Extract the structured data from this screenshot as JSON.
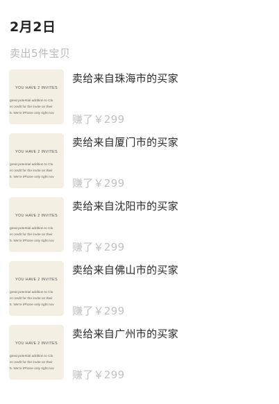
{
  "header": {
    "date": "2月2日",
    "summary": "卖出5件宝贝"
  },
  "items": [
    {
      "title": "卖给来自珠海市的买家",
      "earned": "赚了￥299",
      "thumbnail": {
        "heading": "YOU HAVE 2 INVITES",
        "line1": "great potential addition to Clu",
        "line2": "et credit for the invite on their",
        "line3": "5. We're iPhone only right nov"
      }
    },
    {
      "title": "卖给来自厦门市的买家",
      "earned": "赚了￥299",
      "thumbnail": {
        "heading": "YOU HAVE 2 INVITES",
        "line1": "great potential addition to Clu",
        "line2": "et credit for the invite on their",
        "line3": "5. We're iPhone only right nov"
      }
    },
    {
      "title": "卖给来自沈阳市的买家",
      "earned": "赚了￥299",
      "thumbnail": {
        "heading": "YOU HAVE 2 INVITES",
        "line1": "great potential addition to Clu",
        "line2": "et credit for the invite on their",
        "line3": "5. We're iPhone only right nov"
      }
    },
    {
      "title": "卖给来自佛山市的买家",
      "earned": "赚了￥299",
      "thumbnail": {
        "heading": "YOU HAVE 2 INVITES",
        "line1": "great potential addition to Clu",
        "line2": "et credit for the invite on their",
        "line3": "5. We're iPhone only right nov"
      }
    },
    {
      "title": "卖给来自广州市的买家",
      "earned": "赚了￥299",
      "thumbnail": {
        "heading": "YOU HAVE 2 INVITES",
        "line1": "great potential addition to Clu",
        "line2": "et credit for the invite on their",
        "line3": "5. We're iPhone only right nov"
      }
    }
  ],
  "colors": {
    "thumbnail_bg": "#f3efe3",
    "title_text": "#2a2a2a",
    "muted_text": "#c1c1c1"
  }
}
